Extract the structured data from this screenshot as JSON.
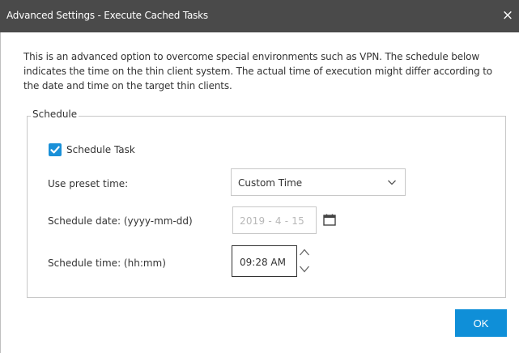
{
  "window": {
    "title": "Advanced Settings - Execute Cached Tasks",
    "close_glyph": "×",
    "close_icon": "close-icon"
  },
  "description": "This is an advanced option to overcome special environments such as VPN. The schedule below indicates the time on the thin client system. The actual time of execution might differ according to the date and time on the target thin clients.",
  "schedule": {
    "legend": "Schedule",
    "schedule_task_label": "Schedule Task",
    "schedule_task_checked": true,
    "preset_label": "Use preset time:",
    "preset_value": "Custom Time",
    "date_label": "Schedule date: (yyyy-mm-dd)",
    "date_value": "2019 - 4 - 15",
    "time_label": "Schedule time: (hh:mm)",
    "time_value": "09:28 AM"
  },
  "footer": {
    "ok_label": "OK"
  },
  "colors": {
    "titlebar": "#4a4a4a",
    "accent": "#1a90d8",
    "ok_button": "#0f8fd8",
    "disabled_text": "#b8b8b8"
  }
}
